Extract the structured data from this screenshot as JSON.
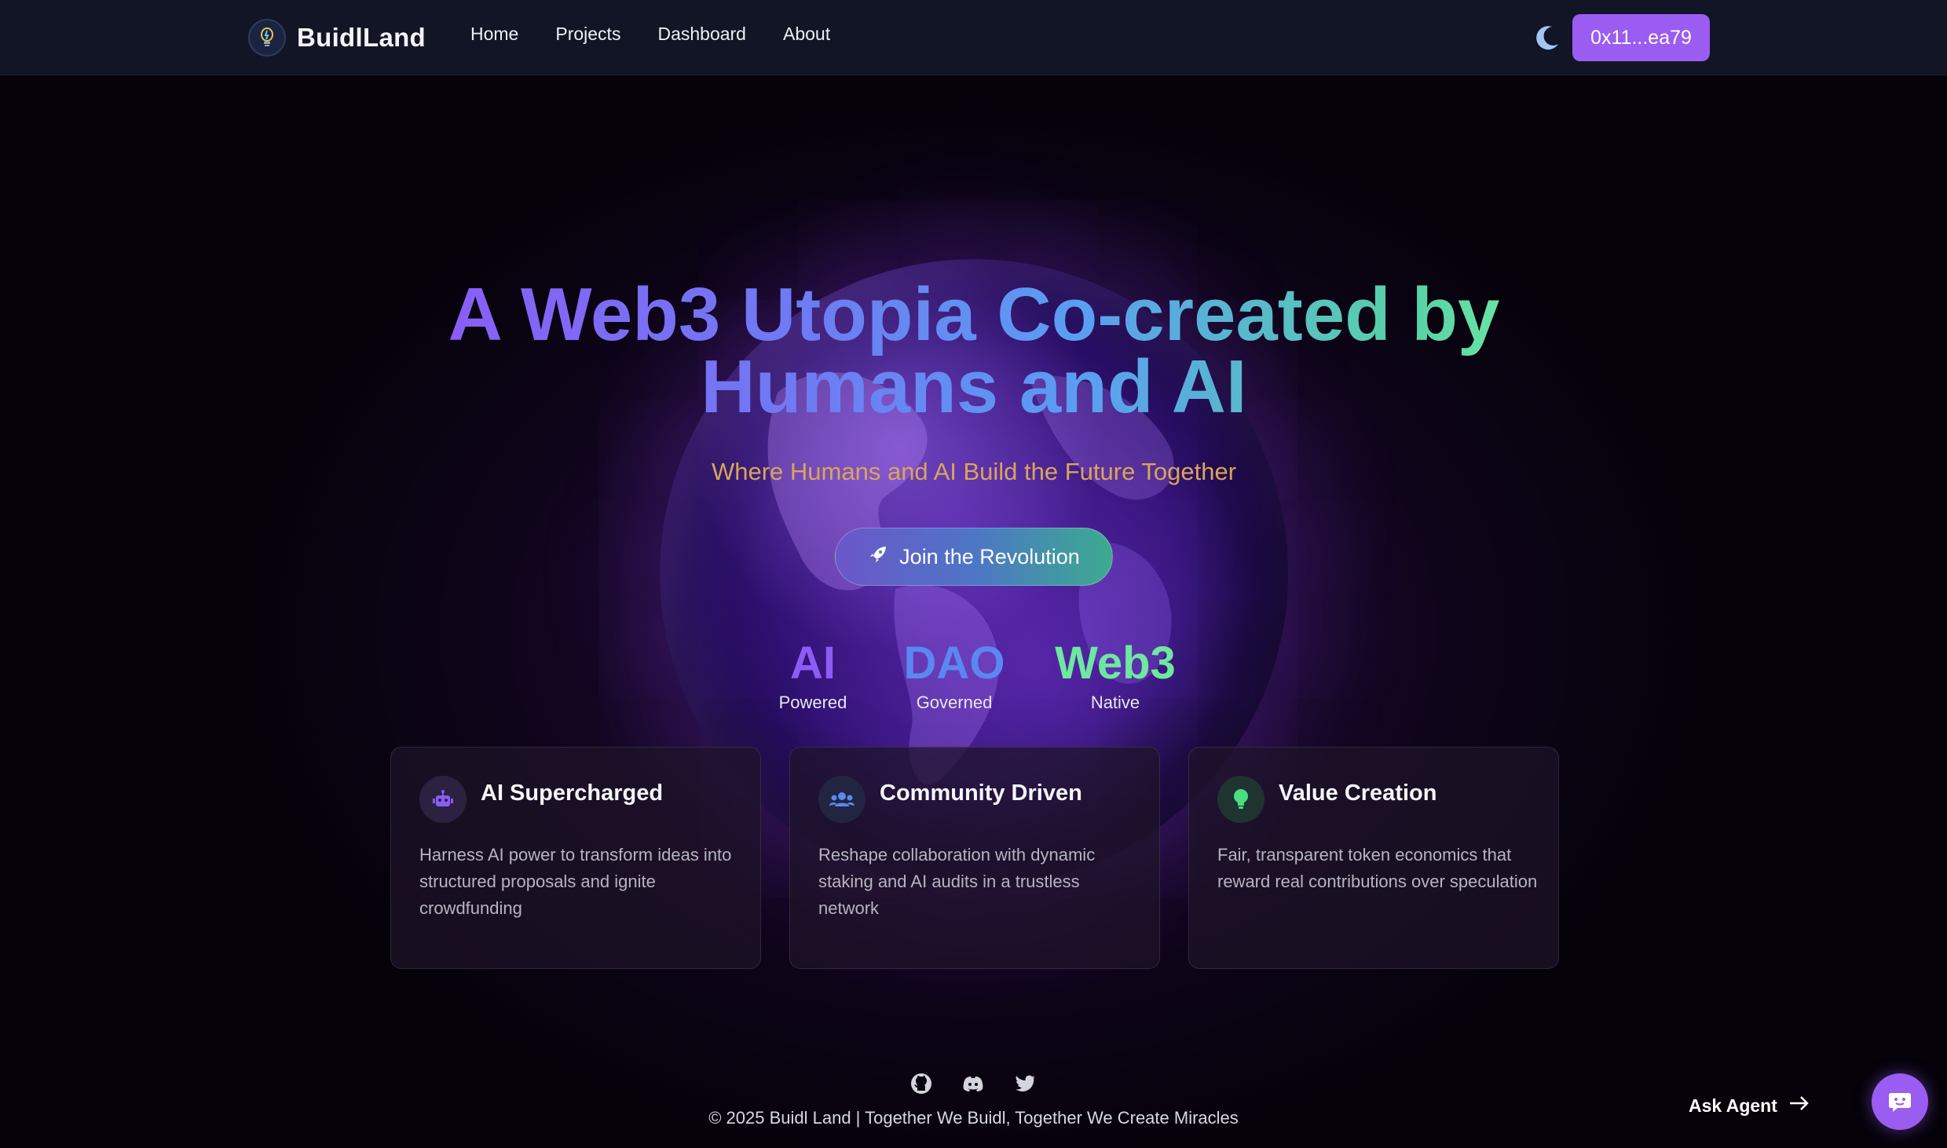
{
  "nav": {
    "brand": "BuidlLand",
    "links": [
      "Home",
      "Projects",
      "Dashboard",
      "About"
    ],
    "wallet": "0x11...ea79"
  },
  "hero": {
    "title": "A Web3 Utopia Co-created by Humans and AI",
    "subtitle": "Where Humans and AI Build the Future Together",
    "cta": "Join the Revolution"
  },
  "stats": [
    {
      "value": "AI",
      "label": "Powered",
      "color": "#8b5cf6"
    },
    {
      "value": "DAO",
      "label": "Governed",
      "color": "#5b87f0"
    },
    {
      "value": "Web3",
      "label": "Native",
      "color": "#6ee7a0"
    }
  ],
  "features": [
    {
      "title": "AI Supercharged",
      "desc": "Harness AI power to transform ideas into structured proposals and ignite crowdfunding",
      "icon": "robot-icon"
    },
    {
      "title": "Community Driven",
      "desc": "Reshape collaboration with dynamic staking and AI audits in a trustless network",
      "icon": "users-icon"
    },
    {
      "title": "Value Creation",
      "desc": "Fair, transparent token economics that reward real contributions over speculation",
      "icon": "lightbulb-icon"
    }
  ],
  "footer": {
    "copyright": "© 2025 Buidl Land | Together We Buidl, Together We Create Miracles",
    "social": [
      "github-icon",
      "discord-icon",
      "twitter-icon"
    ]
  },
  "agent": {
    "label": "Ask Agent"
  },
  "colors": {
    "accent": "#9b5cf2",
    "subtitle": "#d9a55a"
  }
}
